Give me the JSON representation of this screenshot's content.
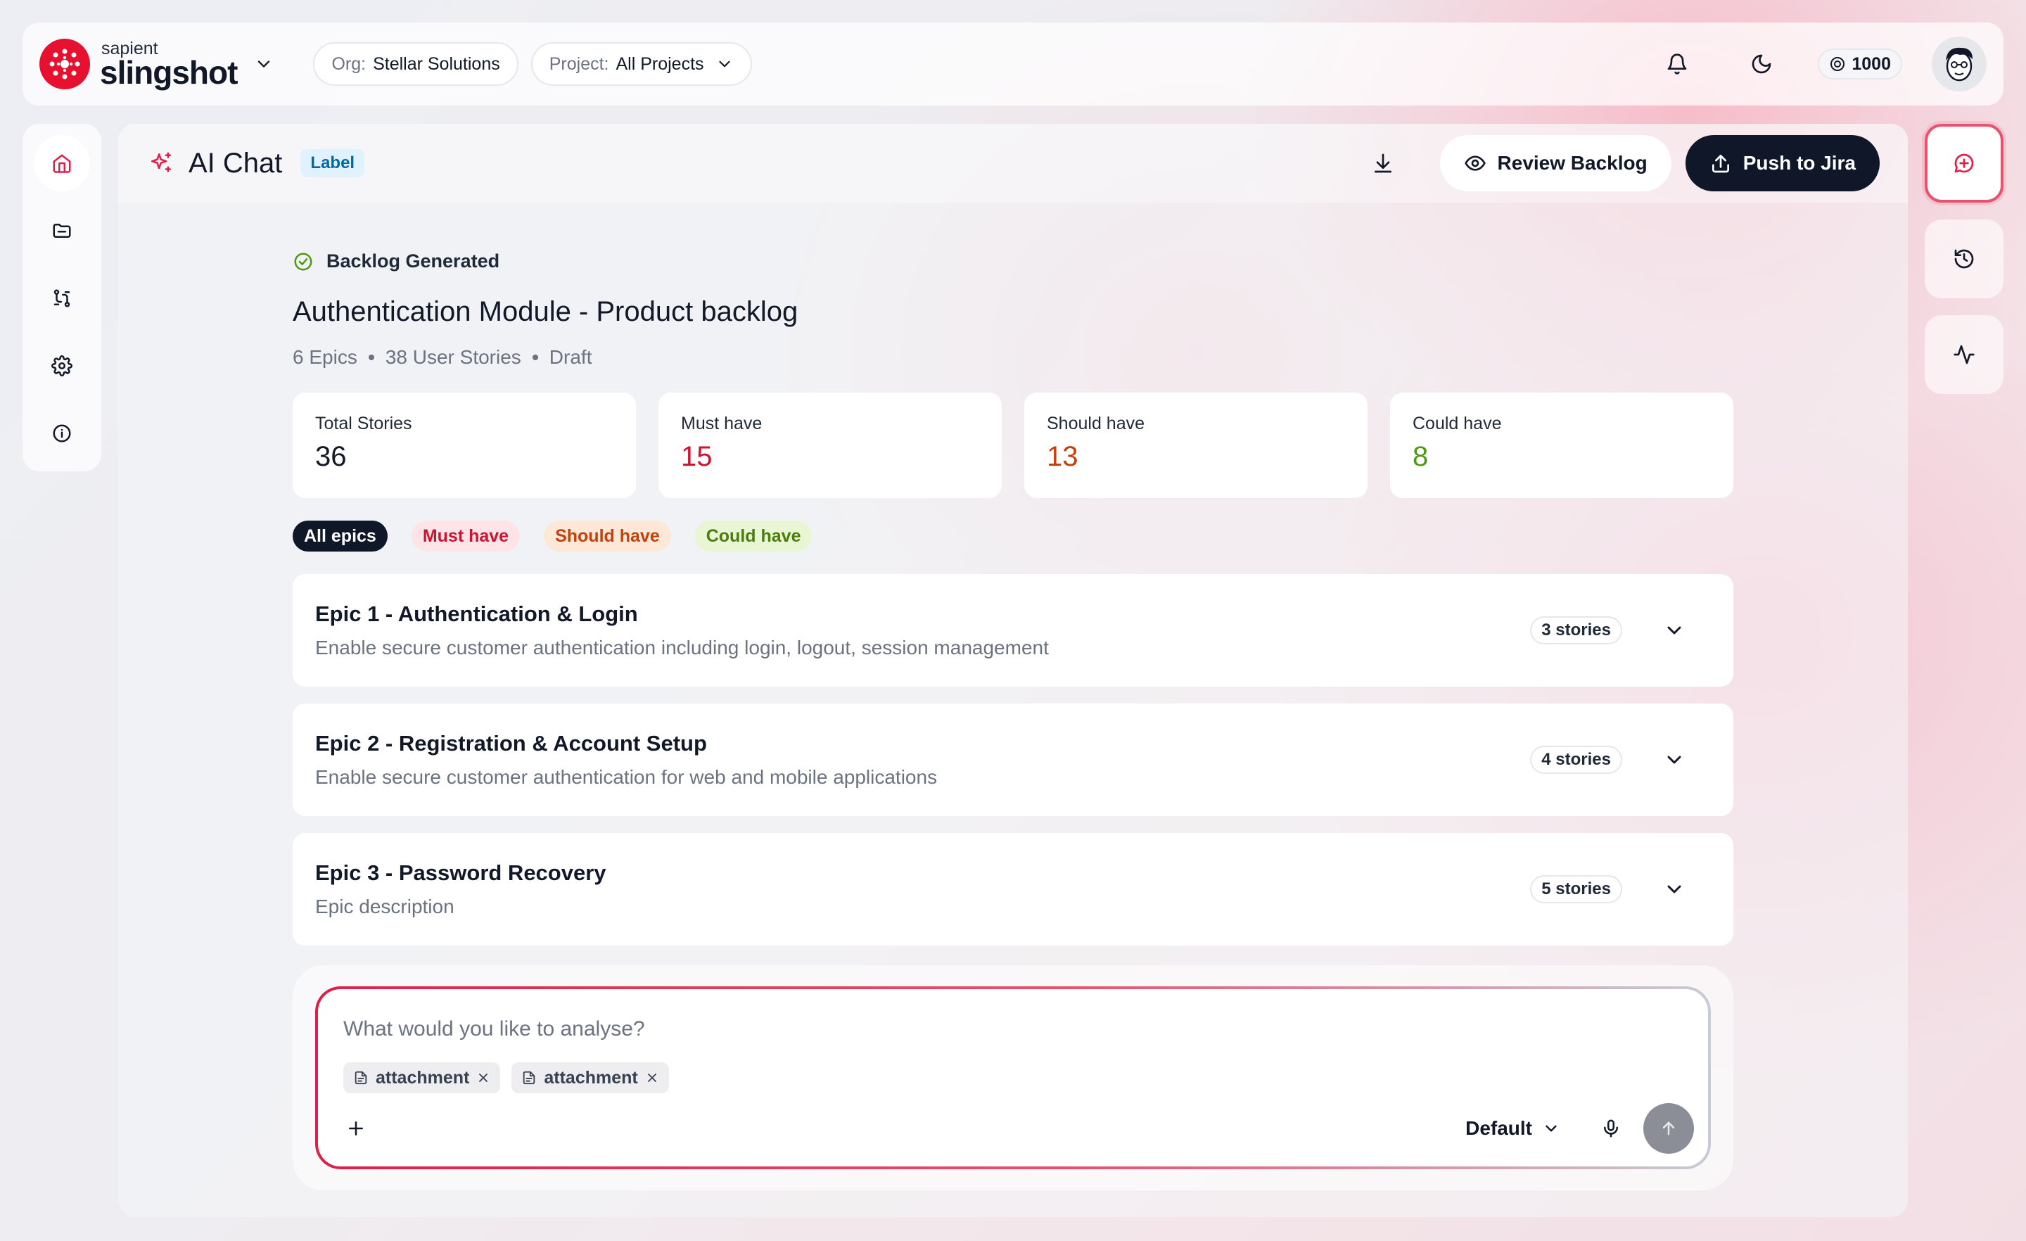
{
  "brand": {
    "small": "sapient",
    "big": "slingshot",
    "color": "#e8102f"
  },
  "org": {
    "label": "Org:",
    "value": "Stellar Solutions"
  },
  "project": {
    "label": "Project:",
    "value": "All Projects"
  },
  "credits": "1000",
  "sidebar": {
    "items": [
      {
        "icon": "home-icon"
      },
      {
        "icon": "folder-icon"
      },
      {
        "icon": "workflow-icon"
      },
      {
        "icon": "gear-icon"
      },
      {
        "icon": "info-icon"
      }
    ]
  },
  "header": {
    "title": "AI Chat",
    "badge": "Label",
    "review_label": "Review Backlog",
    "push_label": "Push to Jira"
  },
  "backlog": {
    "status": "Backlog Generated",
    "title": "Authentication Module - Product backlog",
    "meta": [
      "6 Epics",
      "38 User Stories",
      "Draft"
    ],
    "stats": [
      {
        "label": "Total Stories",
        "value": "36",
        "color": "#111827"
      },
      {
        "label": "Must have",
        "value": "15",
        "color": "#d0132f"
      },
      {
        "label": "Should have",
        "value": "13",
        "color": "#c2410c"
      },
      {
        "label": "Could have",
        "value": "8",
        "color": "#4d9a0f"
      }
    ],
    "filters": [
      "All epics",
      "Must have",
      "Should have",
      "Could have"
    ],
    "epics": [
      {
        "title": "Epic 1 - Authentication & Login",
        "desc": "Enable secure customer authentication including login, logout, session management",
        "stories": "3 stories"
      },
      {
        "title": "Epic 2 - Registration & Account Setup",
        "desc": "Enable secure customer authentication for web and mobile applications",
        "stories": "4 stories"
      },
      {
        "title": "Epic 3 - Password Recovery",
        "desc": "Epic description",
        "stories": "5 stories"
      }
    ]
  },
  "composer": {
    "placeholder": "What would you like to analyse?",
    "attachments": [
      "attachment",
      "attachment"
    ],
    "model": "Default"
  }
}
